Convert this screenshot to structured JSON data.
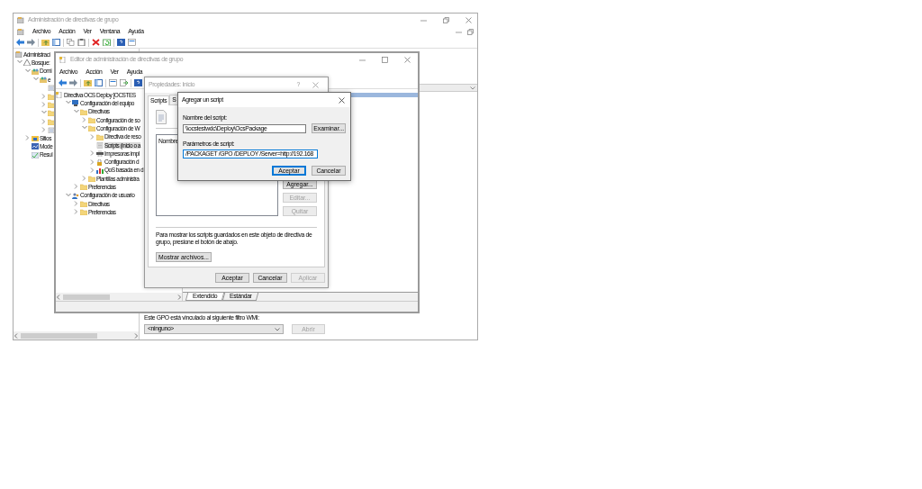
{
  "main_window": {
    "title": "Administración de directivas de grupo",
    "menu": [
      "Archivo",
      "Acción",
      "Ver",
      "Ventana",
      "Ayuda"
    ],
    "tree": [
      {
        "label": "Administraci",
        "kind": "console",
        "selected": false
      },
      {
        "label": "Bosque:",
        "kind": "forest",
        "expanded": true,
        "selected": false,
        "children": [
          {
            "label": "Domi",
            "kind": "domain",
            "expanded": true,
            "selected": false,
            "children": [
              {
                "label": "e",
                "kind": "domain",
                "expanded": true,
                "selected": false,
                "children": [
                  {
                    "kind": "gpo",
                    "selected": false
                  },
                  {
                    "kind": "folder",
                    "expanded": false,
                    "selected": false
                  },
                  {
                    "kind": "folder",
                    "expanded": false,
                    "selected": false
                  },
                  {
                    "kind": "folder",
                    "expanded": true,
                    "selected": false
                  },
                  {
                    "kind": "folder",
                    "expanded": false,
                    "selected": false
                  },
                  {
                    "kind": "gpo",
                    "expanded": false,
                    "selected": false
                  }
                ]
              }
            ]
          },
          {
            "label": "Sitios",
            "kind": "sites",
            "expanded": false,
            "selected": false
          },
          {
            "label": "Mode",
            "kind": "modeling",
            "selected": false
          },
          {
            "label": "Resul",
            "kind": "results",
            "selected": false
          }
        ]
      }
    ],
    "wmi": {
      "label": "Este GPO está vinculado al siguiente filtro WMI:",
      "value": "<ninguno>",
      "button": "Abrir",
      "button_disabled": true
    }
  },
  "editor_window": {
    "title": "Editor de administración de directivas de grupo",
    "menu": [
      "Archivo",
      "Acción",
      "Ver",
      "Ayuda"
    ],
    "tree": [
      {
        "label": "Directiva OCS Deploy [OCSTES",
        "kind": "policy",
        "selected": false,
        "children": [
          {
            "label": "Configuración del equipo",
            "kind": "computer",
            "expanded": true,
            "selected": false,
            "children": [
              {
                "label": "Directivas",
                "kind": "folder",
                "expanded": true,
                "selected": false,
                "children": [
                  {
                    "label": "Configuración de so",
                    "kind": "folder",
                    "expanded": false,
                    "selected": false
                  },
                  {
                    "label": "Configuración de W",
                    "kind": "folder",
                    "expanded": true,
                    "selected": false,
                    "children": [
                      {
                        "label": "Directiva de reso",
                        "kind": "folder",
                        "expanded": false,
                        "selected": false
                      },
                      {
                        "label": "Scripts (inicio o a",
                        "kind": "scripts",
                        "selected": true
                      },
                      {
                        "label": "Impresoras impl",
                        "kind": "printer",
                        "expanded": false,
                        "selected": false
                      },
                      {
                        "label": "Configuración d",
                        "kind": "security",
                        "expanded": false,
                        "selected": false
                      },
                      {
                        "label": "QoS basada en d",
                        "kind": "chart",
                        "expanded": false,
                        "selected": false
                      }
                    ]
                  },
                  {
                    "label": "Plantillas administra",
                    "kind": "folder",
                    "expanded": false,
                    "selected": false
                  }
                ]
              },
              {
                "label": "Preferencias",
                "kind": "folder",
                "expanded": false,
                "selected": false
              }
            ]
          },
          {
            "label": "Configuración de usuario",
            "kind": "user",
            "expanded": true,
            "selected": false,
            "children": [
              {
                "label": "Directivas",
                "kind": "folder",
                "expanded": false,
                "selected": false
              },
              {
                "label": "Preferencias",
                "kind": "folder",
                "expanded": false,
                "selected": false
              }
            ]
          }
        ]
      }
    ],
    "view_tabs": [
      {
        "label": "Extendido",
        "selected": true
      },
      {
        "label": "Estándar",
        "selected": false
      }
    ]
  },
  "properties_dialog": {
    "title": "Propiedades: Inicio",
    "help_button": "?",
    "tabs": [
      {
        "label": "Scripts",
        "selected": true
      },
      {
        "label": "S",
        "selected": false
      }
    ],
    "list_header": "Nombre",
    "side_buttons": [
      {
        "label": "Agregar...",
        "disabled": false
      },
      {
        "label": "Editar...",
        "disabled": true
      },
      {
        "label": "Quitar",
        "disabled": true
      }
    ],
    "info": "Para mostrar los scripts guardados en este objeto de directiva de grupo, presione el botón de abajo.",
    "show_files_button": "Mostrar archivos...",
    "buttons": [
      {
        "label": "Aceptar",
        "disabled": false
      },
      {
        "label": "Cancelar",
        "disabled": false
      },
      {
        "label": "Aplicar",
        "disabled": true
      }
    ]
  },
  "add_script_dialog": {
    "title": "Agregar un script",
    "fields": [
      {
        "label": "Nombre del script:",
        "value": "\\\\ocstestwdc\\Deploy\\OcsPackage",
        "focused": false,
        "button": "Examinar..."
      },
      {
        "label": "Parámetros de script:",
        "value": "/PACKAGET /GPO /DEPLOY /Server=http://192.168",
        "focused": true
      }
    ],
    "buttons": [
      {
        "label": "Aceptar",
        "default": true
      },
      {
        "label": "Cancelar",
        "default": false
      }
    ]
  }
}
